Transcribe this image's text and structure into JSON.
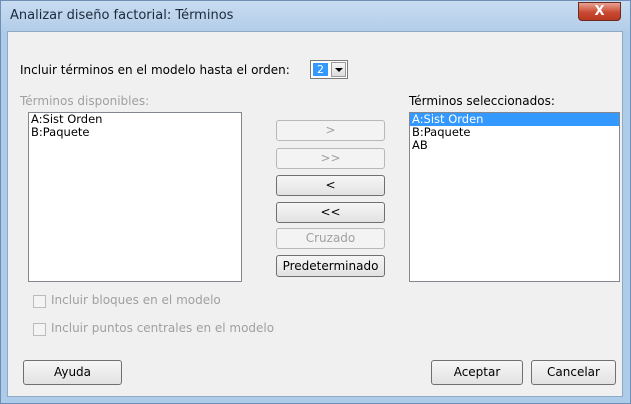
{
  "window": {
    "title": "Analizar diseño factorial: Términos",
    "close_label": "X"
  },
  "order": {
    "label": "Incluir términos en el modelo hasta el orden:",
    "value": "2"
  },
  "available": {
    "label": "Términos disponibles:",
    "items": [
      "A:Sist Orden",
      "B:Paquete"
    ]
  },
  "selected": {
    "label": "Términos seleccionados:",
    "items": [
      "A:Sist Orden",
      "B:Paquete",
      "AB"
    ],
    "selected_index": 0
  },
  "buttons": {
    "add": ">",
    "add_all": ">>",
    "remove": "<",
    "remove_all": "<<",
    "crossed": "Cruzado",
    "default": "Predeterminado"
  },
  "options": {
    "blocks": "Incluir bloques en el modelo",
    "center_points": "Incluir puntos centrales en el modelo"
  },
  "footer": {
    "help": "Ayuda",
    "ok": "Aceptar",
    "cancel": "Cancelar"
  }
}
